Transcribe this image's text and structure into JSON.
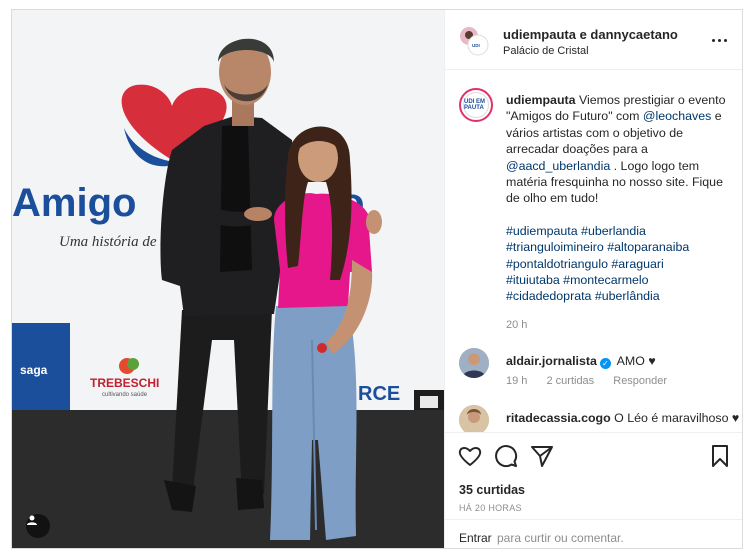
{
  "post": {
    "header": {
      "usernames": "udiempauta e dannycaetano",
      "location": "Palácio de Cristal"
    },
    "caption": {
      "username": "udiempauta",
      "text_1": "Viemos prestigiar o evento \"Amigos do Futuro\" com",
      "mention_1": "@leochaves",
      "text_2": "e vários artistas com o objetivo de arrecadar doações para a",
      "mention_2": "@aacd_uberlandia",
      "text_3": ". Logo logo tem matéria fresquinha no nosso site. Fique de olho em tudo!",
      "hashtags_line_1": "#udiempauta #uberlandia",
      "hashtags_line_2": "#trianguloimineiro #altoparanaiba",
      "hashtags_line_3": "#pontaldotriangulo #araguari",
      "hashtags_line_4": "#ituiutaba #montecarmelo",
      "hashtags_line_5": "#cidadedoprata #uberlândia",
      "time": "20 h"
    },
    "comments": [
      {
        "username": "aldair.jornalista",
        "text": "AMO ♥",
        "time": "19 h",
        "likes": "2 curtidas",
        "reply": "Responder"
      },
      {
        "username": "ritadecassia.cogo",
        "text": "O Léo é maravilhoso ♥"
      }
    ],
    "likes": "35 curtidas",
    "posted": "HÁ 20 HORAS",
    "add_comment": {
      "enter": "Entrar",
      "placeholder": "para curtir ou comentar."
    },
    "photo_text": {
      "banner_title": "Amigo",
      "banner_title_end": "o",
      "banner_subtitle": "Uma história de",
      "sponsor_1": "saga",
      "sponsor_2": "TREBESCHI",
      "sponsor_2_sub": "cultivando saúde",
      "sponsor_3": "RCE",
      "avatar_logo": "UDI EM PAUTA"
    },
    "icons": {
      "like": "heart-icon",
      "comment": "comment-icon",
      "share": "send-icon",
      "save": "bookmark-icon",
      "more": "more-icon",
      "tag": "user-tag-icon"
    },
    "colors": {
      "link": "#00376b",
      "verified": "#0095f6",
      "banner_blue": "#1b4e9b",
      "shirt_pink": "#e5178a"
    }
  }
}
